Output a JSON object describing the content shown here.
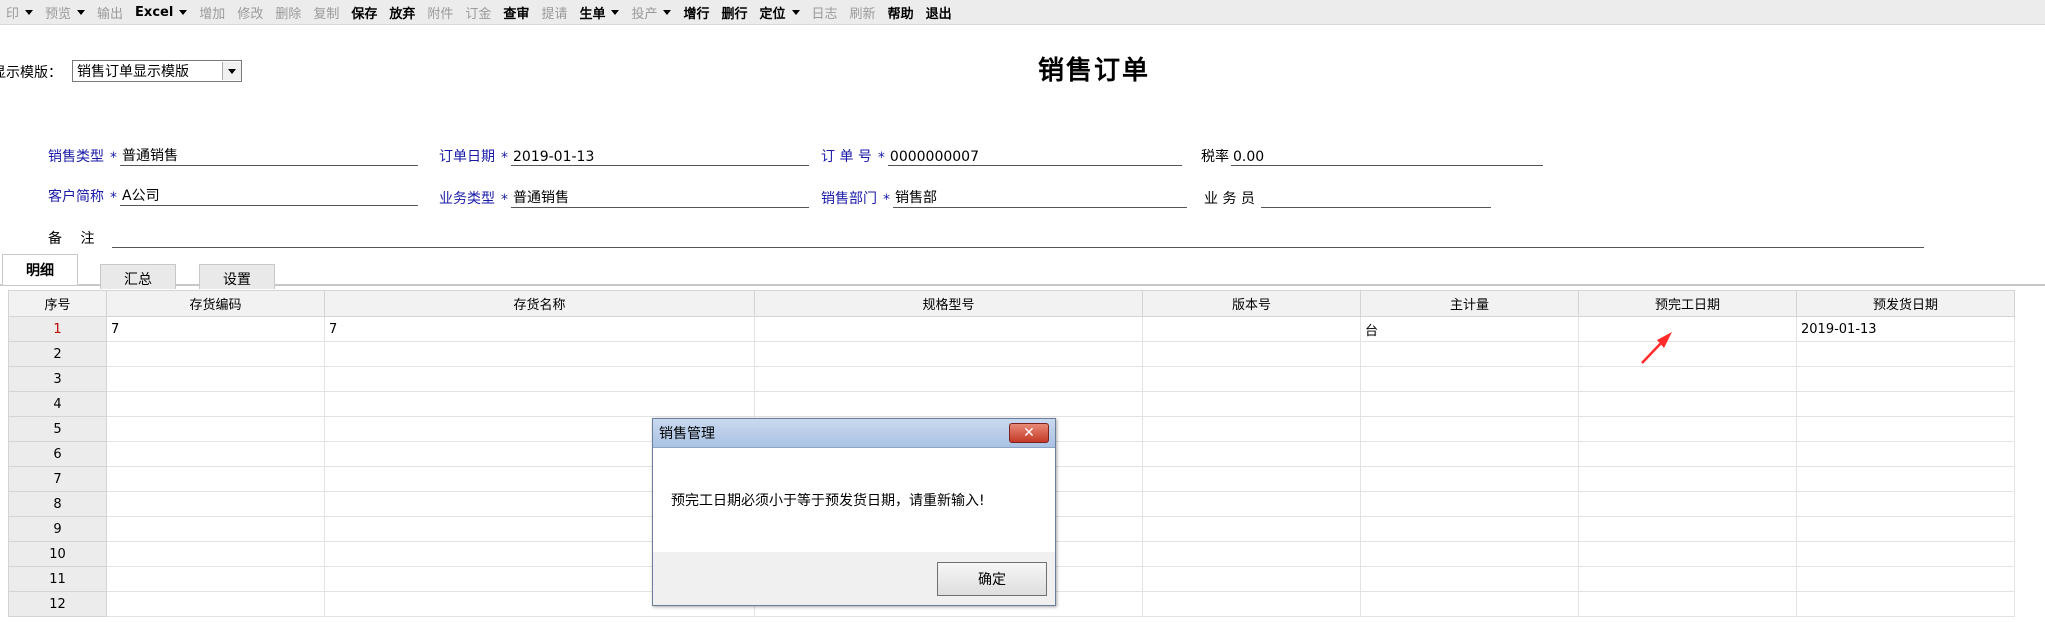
{
  "toolbar": {
    "items": [
      {
        "label": "印",
        "dropdown": true,
        "enabled": false
      },
      {
        "label": "预览",
        "dropdown": true,
        "enabled": false
      },
      {
        "label": "输出",
        "dropdown": false,
        "enabled": false
      },
      {
        "label": "Excel",
        "dropdown": true,
        "enabled": true
      },
      {
        "label": "增加",
        "dropdown": false,
        "enabled": false
      },
      {
        "label": "修改",
        "dropdown": false,
        "enabled": false
      },
      {
        "label": "删除",
        "dropdown": false,
        "enabled": false
      },
      {
        "label": "复制",
        "dropdown": false,
        "enabled": false
      },
      {
        "label": "保存",
        "dropdown": false,
        "enabled": true
      },
      {
        "label": "放弃",
        "dropdown": false,
        "enabled": true
      },
      {
        "label": "附件",
        "dropdown": false,
        "enabled": false
      },
      {
        "label": "订金",
        "dropdown": false,
        "enabled": false
      },
      {
        "label": "查审",
        "dropdown": false,
        "enabled": true
      },
      {
        "label": "提请",
        "dropdown": false,
        "enabled": false
      },
      {
        "label": "生单",
        "dropdown": true,
        "enabled": true
      },
      {
        "label": "投产",
        "dropdown": true,
        "enabled": false
      },
      {
        "label": "增行",
        "dropdown": false,
        "enabled": true
      },
      {
        "label": "删行",
        "dropdown": false,
        "enabled": true
      },
      {
        "label": "定位",
        "dropdown": true,
        "enabled": true
      },
      {
        "label": "日志",
        "dropdown": false,
        "enabled": false
      },
      {
        "label": "刷新",
        "dropdown": false,
        "enabled": false
      },
      {
        "label": "帮助",
        "dropdown": false,
        "enabled": true
      },
      {
        "label": "退出",
        "dropdown": false,
        "enabled": true
      }
    ]
  },
  "template": {
    "label": "显示模版：",
    "selected": "销售订单显示模版"
  },
  "page_title": "销售订单",
  "form": {
    "sales_type": {
      "label": "销售类型",
      "value": "普通销售"
    },
    "order_date": {
      "label": "订单日期",
      "value": "2019-01-13"
    },
    "order_no": {
      "label": "订 单 号",
      "value": "0000000007"
    },
    "tax_rate": {
      "label": "税率",
      "value": "0.00"
    },
    "customer": {
      "label": "客户简称",
      "value": "A公司"
    },
    "business_type": {
      "label": "业务类型",
      "value": "普通销售"
    },
    "sales_dept": {
      "label": "销售部门",
      "value": "销售部"
    },
    "salesperson": {
      "label": "业 务 员",
      "value": ""
    },
    "remark": {
      "label": "备　 注",
      "value": ""
    },
    "required_mark": "*"
  },
  "tabs": {
    "detail": "明细",
    "summary": "汇总",
    "settings": "设置"
  },
  "grid": {
    "columns": [
      "序号",
      "存货编码",
      "存货名称",
      "规格型号",
      "版本号",
      "主计量",
      "预完工日期",
      "预发货日期"
    ],
    "rows": [
      [
        "1",
        "7",
        "7",
        "",
        "",
        "台",
        "",
        "2019-01-13"
      ],
      [
        "2",
        "",
        "",
        "",
        "",
        "",
        "",
        ""
      ],
      [
        "3",
        "",
        "",
        "",
        "",
        "",
        "",
        ""
      ],
      [
        "4",
        "",
        "",
        "",
        "",
        "",
        "",
        ""
      ],
      [
        "5",
        "",
        "",
        "",
        "",
        "",
        "",
        ""
      ],
      [
        "6",
        "",
        "",
        "",
        "",
        "",
        "",
        ""
      ],
      [
        "7",
        "",
        "",
        "",
        "",
        "",
        "",
        ""
      ],
      [
        "8",
        "",
        "",
        "",
        "",
        "",
        "",
        ""
      ],
      [
        "9",
        "",
        "",
        "",
        "",
        "",
        "",
        ""
      ],
      [
        "10",
        "",
        "",
        "",
        "",
        "",
        "",
        ""
      ],
      [
        "11",
        "",
        "",
        "",
        "",
        "",
        "",
        ""
      ],
      [
        "12",
        "",
        "",
        "",
        "",
        "",
        "",
        ""
      ]
    ]
  },
  "dialog": {
    "title": "销售管理",
    "close_icon": "close-icon",
    "message": "预完工日期必须小于等于预发货日期，请重新输入!",
    "ok_label": "确定"
  },
  "colors": {
    "label_blue": "#1a1aa8",
    "arrow_red": "#ff2a2a",
    "first_row_num": "#c00000"
  }
}
